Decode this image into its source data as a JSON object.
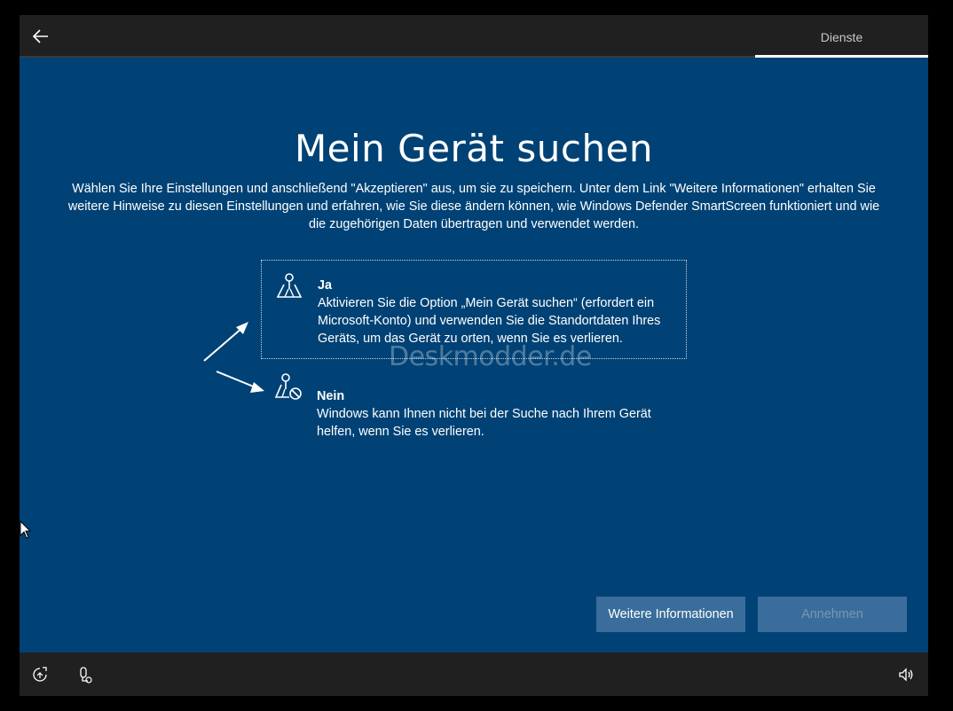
{
  "topbar": {
    "back_icon": "back-arrow-icon",
    "tab_label": "Dienste"
  },
  "main": {
    "title": "Mein Gerät suchen",
    "intro": "Wählen Sie Ihre Einstellungen und anschließend \"Akzeptieren\" aus, um sie zu speichern. Unter dem Link \"Weitere Informationen\" erhalten Sie weitere Hinweise zu diesen Einstellungen und erfahren, wie Sie diese ändern können, wie Windows Defender SmartScreen funktioniert und wie die zugehörigen Daten übertragen und verwendet werden.",
    "options": [
      {
        "label": "Ja",
        "description": "Aktivieren Sie die Option „Mein Gerät suchen“ (erfordert ein Microsoft-Konto) und verwenden Sie die Standortdaten Ihres Geräts, um das Gerät zu orten, wenn Sie es verlieren.",
        "icon": "map-pin-icon"
      },
      {
        "label": "Nein",
        "description": "Windows kann Ihnen nicht bei der Suche nach Ihrem Gerät helfen, wenn Sie es verlieren.",
        "icon": "map-pin-blocked-icon"
      }
    ],
    "watermark": "Deskmodder.de"
  },
  "buttons": {
    "more_info": "Weitere Informationen",
    "accept": "Annehmen"
  },
  "bottombar": {
    "icons": [
      "ease-of-access-icon",
      "microphone-icon",
      "volume-icon"
    ]
  },
  "colors": {
    "background": "#004275",
    "bar": "#202020",
    "button": "#3a6d9b",
    "button_disabled_text": "#7996b4"
  }
}
